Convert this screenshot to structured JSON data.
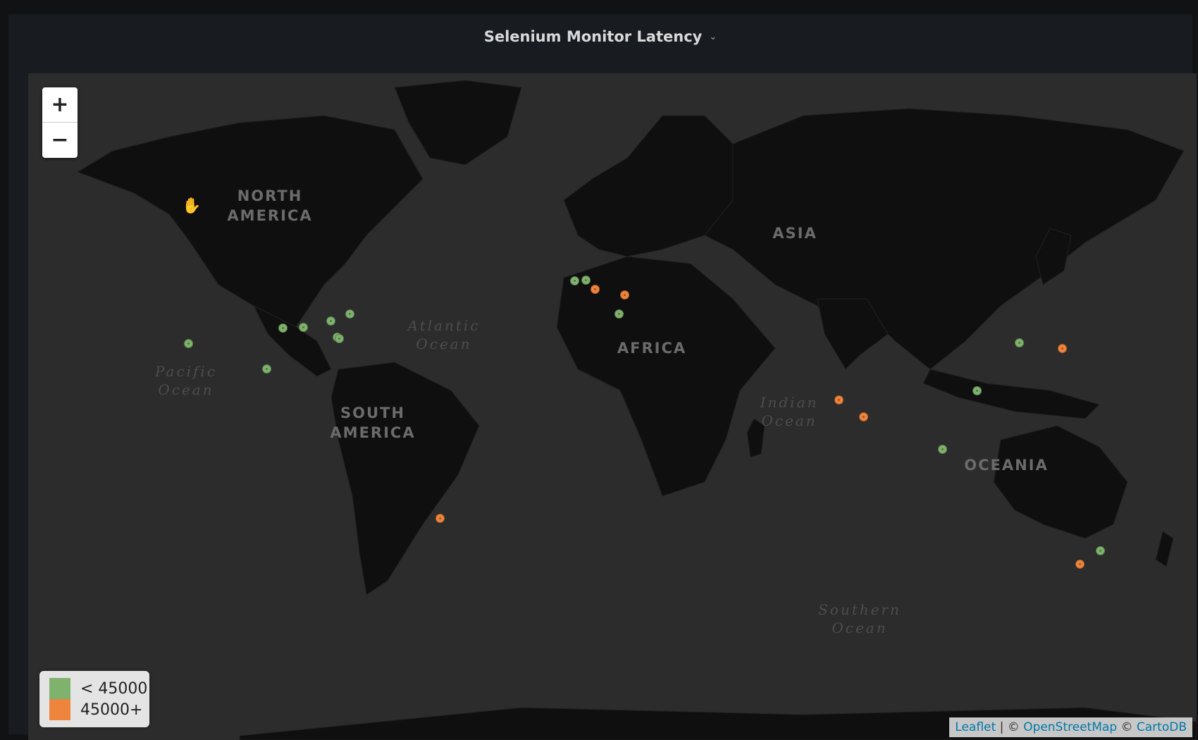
{
  "panel": {
    "title": "Selenium Monitor Latency",
    "title_menu_icon": "chevron-down-icon"
  },
  "map": {
    "zoom_in_label": "+",
    "zoom_out_label": "−",
    "region_labels": [
      "NORTH\nAMERICA",
      "SOUTH\nAMERICA",
      "AFRICA",
      "ASIA",
      "OCEANIA"
    ],
    "ocean_labels": [
      "Pacific\nOcean",
      "Atlantic\nOcean",
      "Indian\nOcean",
      "Southern\nOcean"
    ],
    "legend": [
      {
        "label": "< 45000",
        "color": "#7eb26d"
      },
      {
        "label": "45000+",
        "color": "#ef843c"
      }
    ],
    "attribution": {
      "leaflet": "Leaflet",
      "sep": " | © ",
      "osm": "OpenStreetMap",
      "sep2": " © ",
      "carto": "CartoDB"
    },
    "markers": [
      {
        "lat": 37.3,
        "lon": -121.9,
        "band": "< 45000"
      },
      {
        "lat": 41.6,
        "lon": -93.6,
        "band": "< 45000"
      },
      {
        "lat": 41.9,
        "lon": -87.6,
        "band": "< 45000"
      },
      {
        "lat": 43.6,
        "lon": -79.4,
        "band": "< 45000"
      },
      {
        "lat": 45.5,
        "lon": -73.6,
        "band": "< 45000"
      },
      {
        "lat": 39.0,
        "lon": -77.5,
        "band": "< 45000"
      },
      {
        "lat": 38.7,
        "lon": -76.8,
        "band": "< 45000"
      },
      {
        "lat": 29.4,
        "lon": -98.5,
        "band": "< 45000"
      },
      {
        "lat": 53.3,
        "lon": -6.3,
        "band": "< 45000"
      },
      {
        "lat": 53.4,
        "lon": -3.0,
        "band": "< 45000"
      },
      {
        "lat": 51.5,
        "lon": -0.1,
        "band": "45000+"
      },
      {
        "lat": 50.1,
        "lon": 8.7,
        "band": "45000+"
      },
      {
        "lat": 45.5,
        "lon": 7.0,
        "band": "< 45000"
      },
      {
        "lat": -23.5,
        "lon": -46.6,
        "band": "45000+"
      },
      {
        "lat": 19.1,
        "lon": 72.9,
        "band": "45000+"
      },
      {
        "lat": 13.1,
        "lon": 80.3,
        "band": "45000+"
      },
      {
        "lat": 1.3,
        "lon": 103.8,
        "band": "< 45000"
      },
      {
        "lat": 22.3,
        "lon": 114.2,
        "band": "< 45000"
      },
      {
        "lat": 37.5,
        "lon": 127.0,
        "band": "< 45000"
      },
      {
        "lat": 35.7,
        "lon": 139.7,
        "band": "45000+"
      },
      {
        "lat": -33.9,
        "lon": 151.2,
        "band": "< 45000"
      },
      {
        "lat": -37.8,
        "lon": 145.0,
        "band": "45000+"
      }
    ]
  }
}
